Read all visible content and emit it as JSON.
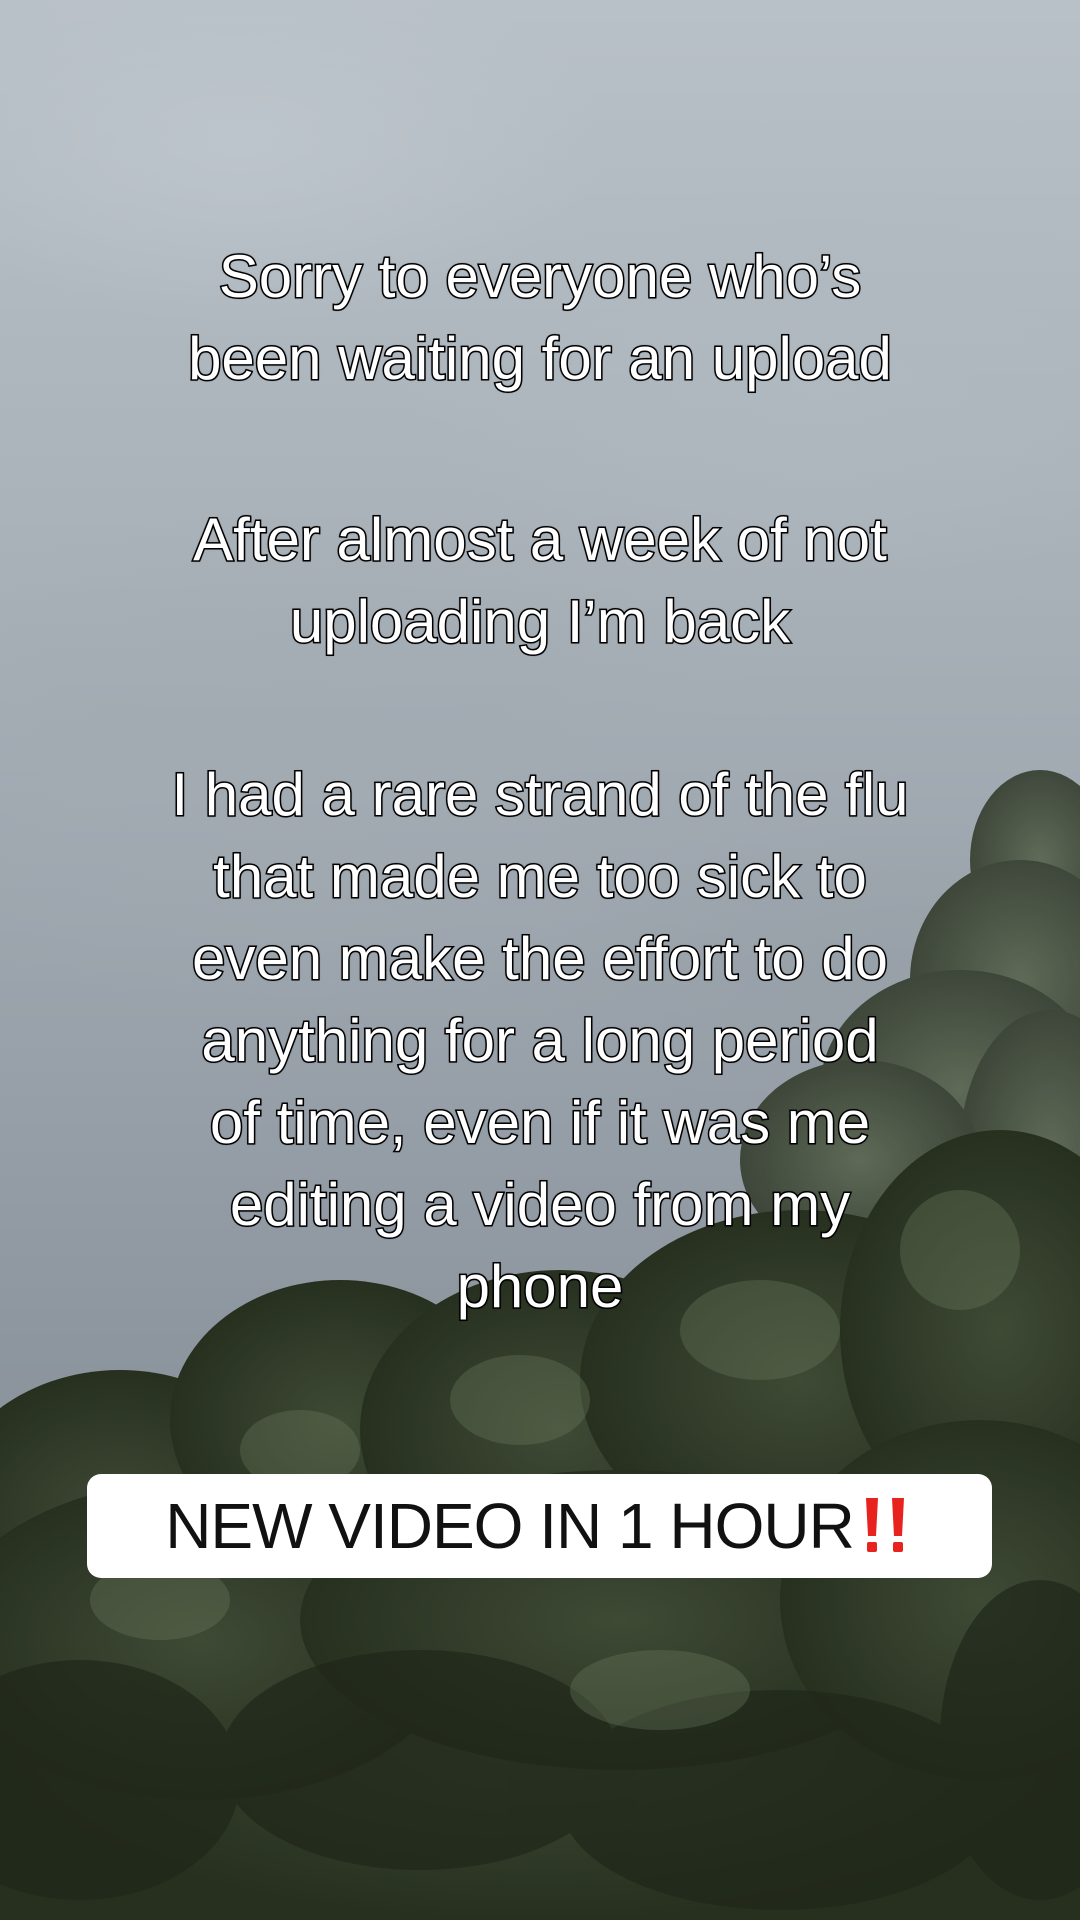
{
  "overlay": {
    "paragraphs": [
      "Sorry to everyone who’s\nbeen waiting for an upload",
      "After almost a week of not\nuploading I’m back",
      "I had a rare strand of the flu\nthat made me too sick to\neven make the effort to do\nanything for a long period\nof time, even if it was me\nediting a video from my\nphone"
    ],
    "banner": {
      "text": "NEW VIDEO IN 1 HOUR",
      "icon": "double-exclamation-icon",
      "icon_color": "#e8231f"
    }
  },
  "colors": {
    "caption_fill": "#ffffff",
    "caption_stroke": "#000000",
    "banner_bg": "#ffffff",
    "banner_text": "#111111"
  }
}
